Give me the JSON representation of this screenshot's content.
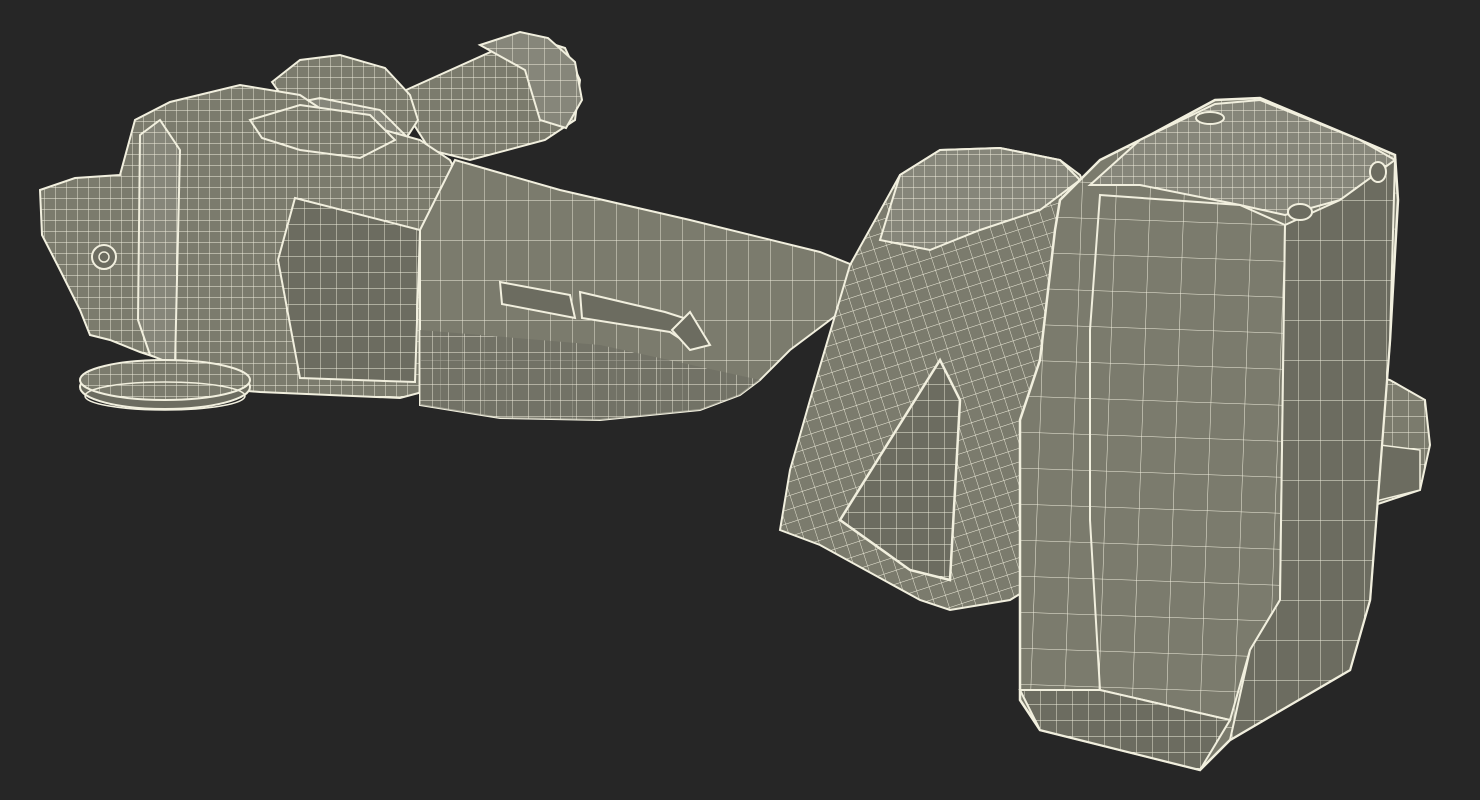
{
  "scene": {
    "subject": "wireframe-3d-model",
    "object_kind": "cordless-angle-grinder",
    "render_style": "wireframe-over-shaded",
    "colors": {
      "background": "#262626",
      "surface_fill": "#7b7b6d",
      "surface_shade": "#6c6c60",
      "surface_light": "#86867a",
      "wire": "#f1efde"
    }
  }
}
